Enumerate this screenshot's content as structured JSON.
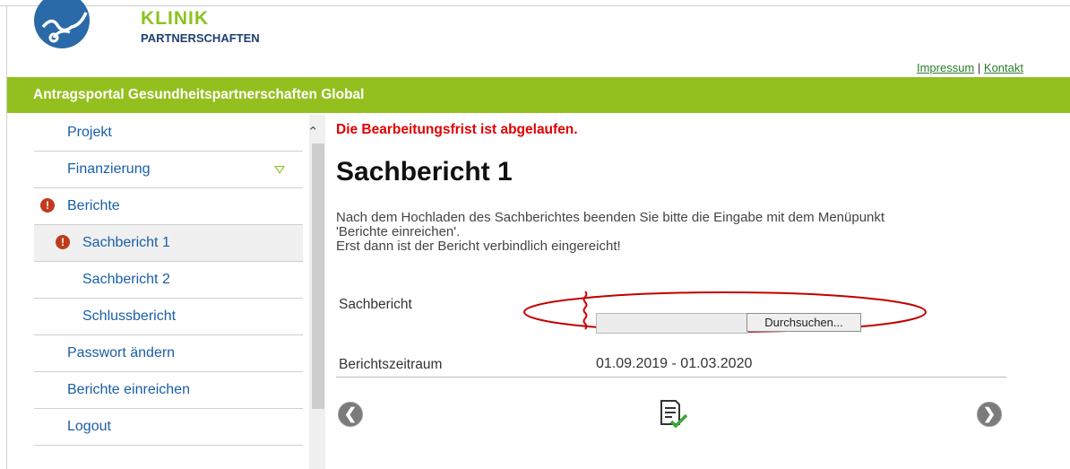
{
  "brand": {
    "line1": "KLINIK",
    "line2": "PARTNERSCHAFTEN"
  },
  "toplinks": {
    "impressum": "Impressum",
    "separator": "|",
    "kontakt": "Kontakt"
  },
  "portal_title": "Antragsportal Gesundheitspartnerschaften Global",
  "sidebar": {
    "items": [
      {
        "label": "Projekt"
      },
      {
        "label": "Finanzierung"
      },
      {
        "label": "Berichte"
      },
      {
        "label": "Sachbericht 1"
      },
      {
        "label": "Sachbericht 2"
      },
      {
        "label": "Schlussbericht"
      },
      {
        "label": "Passwort ändern"
      },
      {
        "label": "Berichte einreichen"
      },
      {
        "label": "Logout"
      }
    ]
  },
  "main": {
    "deadline_notice": "Die Bearbeitungsfrist ist abgelaufen.",
    "title": "Sachbericht 1",
    "description_line1": "Nach dem Hochladen des Sachberichtes beenden Sie bitte die Eingabe mit dem Menüpunkt",
    "description_line2": "'Berichte einreichen'.",
    "description_line3": "Erst dann ist der Bericht verbindlich eingereicht!",
    "sachbericht_label": "Sachbericht",
    "browse_label": "Durchsuchen...",
    "period_label": "Berichtszeitraum",
    "period_value": "01.09.2019 - 01.03.2020"
  },
  "colors": {
    "accent_green": "#93c01f",
    "link_blue": "#1a5ea8",
    "alert_red": "#e00000",
    "highlight_red": "#c00000"
  }
}
